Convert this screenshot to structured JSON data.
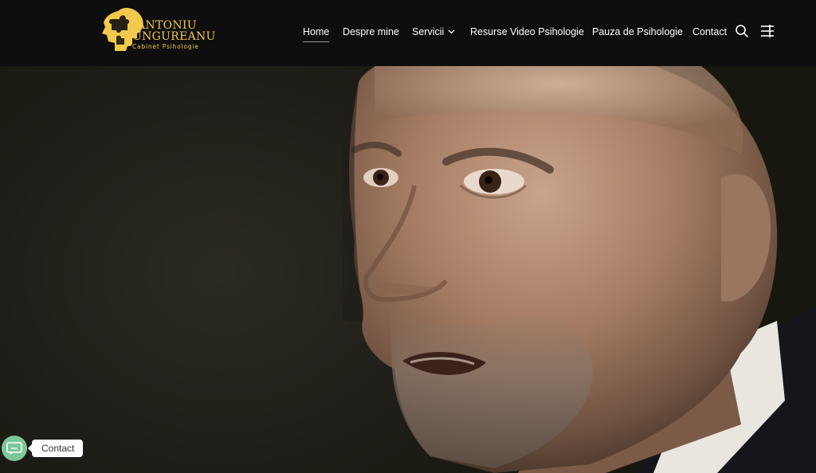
{
  "brand": {
    "line1": "ANTONIU",
    "line2": "UNGUREANU",
    "subtitle": "Cabinet Psihologie",
    "color": "#f2c94c"
  },
  "nav": {
    "items": [
      {
        "label": "Home",
        "active": true
      },
      {
        "label": "Despre mine"
      },
      {
        "label": "Servicii",
        "has_dropdown": true
      },
      {
        "label": "Resurse Video Psihologie"
      },
      {
        "label": "Pauza de Psihologie"
      },
      {
        "label": "Contact"
      }
    ],
    "icons": [
      "search-icon",
      "menu-icon"
    ]
  },
  "hero": {
    "image": "portrait-photo"
  },
  "contact_widget": {
    "label": "Contact",
    "icon": "chat-icon",
    "color": "#7cc69a"
  }
}
